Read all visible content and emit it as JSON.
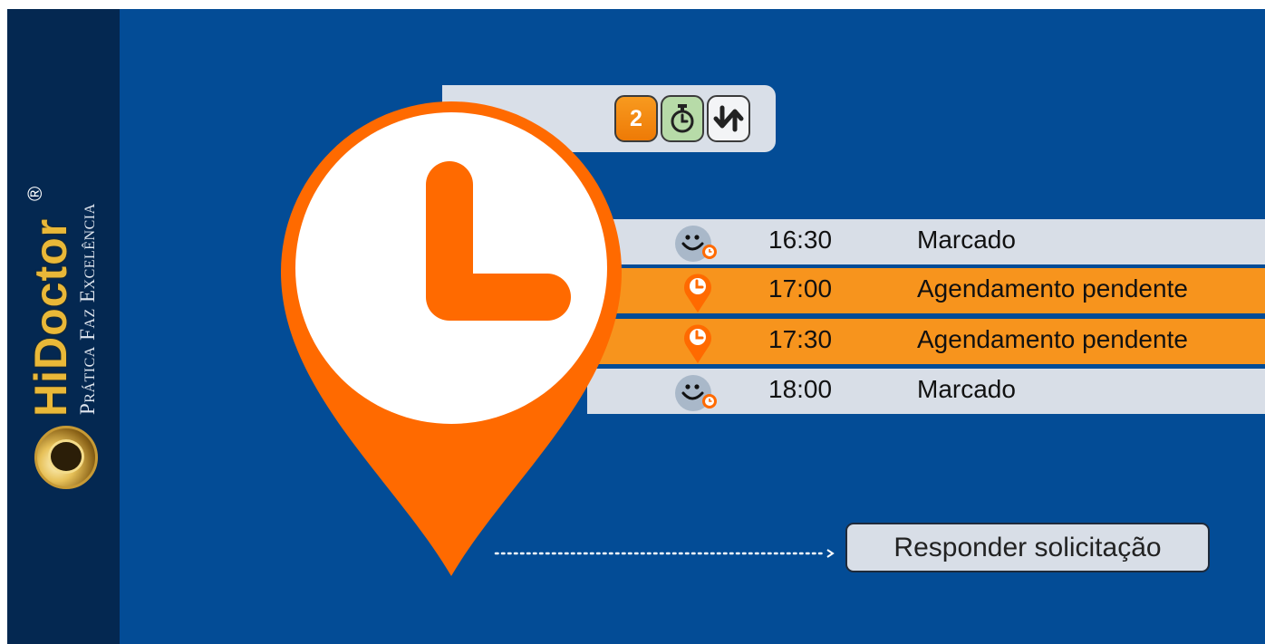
{
  "brand": {
    "name": "HiDoctor",
    "registered": "®",
    "tagline": "Prática Faz Excelência"
  },
  "toolbar": {
    "count_badge": "2",
    "count_icon": "counter-badge",
    "timer_icon": "stopwatch-icon",
    "swap_icon": "swap-arrows-icon"
  },
  "schedule": [
    {
      "time": "16:30",
      "status": "Marcado",
      "state": "confirmed",
      "icon": "smiley-clock-icon"
    },
    {
      "time": "17:00",
      "status": "Agendamento pendente",
      "state": "pending",
      "icon": "pin-clock-icon"
    },
    {
      "time": "17:30",
      "status": "Agendamento pendente",
      "state": "pending",
      "icon": "pin-clock-icon"
    },
    {
      "time": "18:00",
      "status": "Marcado",
      "state": "confirmed",
      "icon": "smiley-clock-icon"
    }
  ],
  "actions": {
    "respond_label": "Responder solicitação"
  },
  "colors": {
    "background": "#034c96",
    "sidebar": "#042851",
    "accent_orange": "#ff6a00",
    "pending_row": "#f7941d",
    "confirmed_row": "#d8dee7",
    "gold": "#e9b838"
  }
}
